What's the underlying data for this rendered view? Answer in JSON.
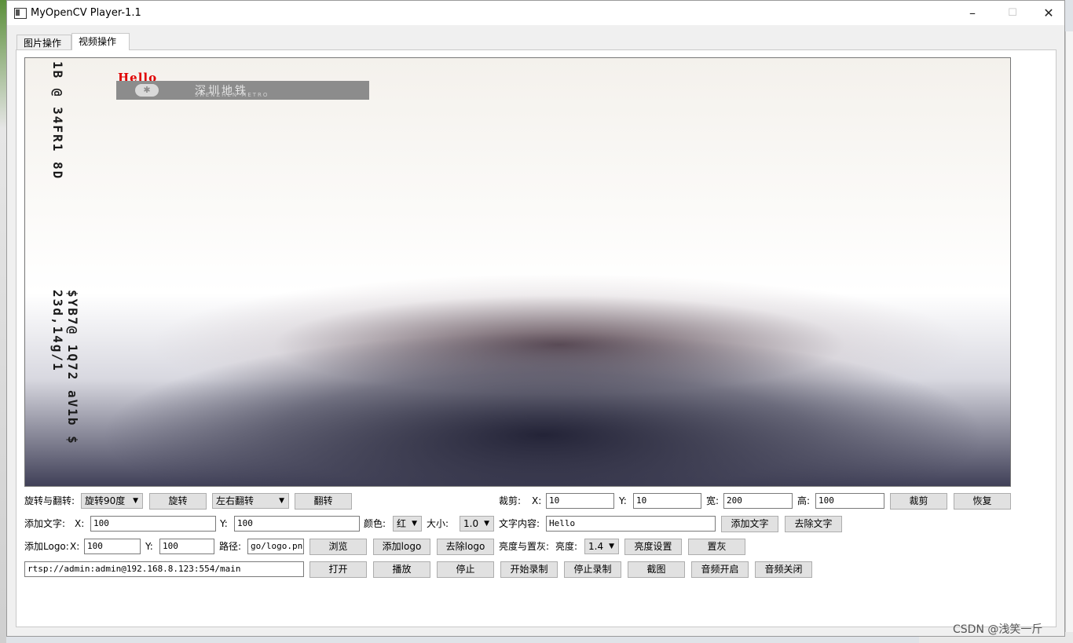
{
  "window": {
    "title": "MyOpenCV Player-1.1"
  },
  "tabs": [
    {
      "label": "图片操作"
    },
    {
      "label": "视频操作"
    }
  ],
  "video": {
    "overlay_text": "Hello",
    "logo_cn": "深圳地铁",
    "logo_en": "SHENZHEN METRO",
    "vertical_text_1": "1B @ 34FR1 8D",
    "vertical_text_2": "$YB7@ 1Q72 aV1b $ 23d,14g/1"
  },
  "row1": {
    "rotate_label": "旋转与翻转:",
    "rotate_select": "旋转90度",
    "rotate_button": "旋转",
    "flip_select": "左右翻转",
    "flip_button": "翻转",
    "crop_label": "裁剪:",
    "x_label": "X:",
    "x_value": "10",
    "y_label": "Y:",
    "y_value": "10",
    "w_label": "宽:",
    "w_value": "200",
    "h_label": "高:",
    "h_value": "100",
    "crop_button": "裁剪",
    "restore_button": "恢复"
  },
  "row2": {
    "text_label": "添加文字:",
    "x_label": "X:",
    "x_value": "100",
    "y_label": "Y:",
    "y_value": "100",
    "color_label": "颜色:",
    "color_select": "红",
    "size_label": "大小:",
    "size_select": "1.0",
    "content_label": "文字内容:",
    "content_value": "Hello",
    "add_text_button": "添加文字",
    "remove_text_button": "去除文字"
  },
  "row3": {
    "logo_label": "添加Logo:",
    "x_label": "X:",
    "x_value": "100",
    "y_label": "Y:",
    "y_value": "100",
    "path_label": "路径:",
    "path_value": "go/logo.png",
    "browse_button": "浏览",
    "add_logo_button": "添加logo",
    "remove_logo_button": "去除logo",
    "brightness_group_label": "亮度与置灰:",
    "brightness_label": "亮度:",
    "brightness_select": "1.4",
    "brightness_button": "亮度设置",
    "gray_button": "置灰"
  },
  "row4": {
    "url_value": "rtsp://admin:admin@192.168.8.123:554/main",
    "open_button": "打开",
    "play_button": "播放",
    "stop_button": "停止",
    "start_record_button": "开始录制",
    "stop_record_button": "停止录制",
    "screenshot_button": "截图",
    "audio_on_button": "音频开启",
    "audio_off_button": "音频关闭"
  },
  "watermark": "CSDN @浅笑一斤"
}
